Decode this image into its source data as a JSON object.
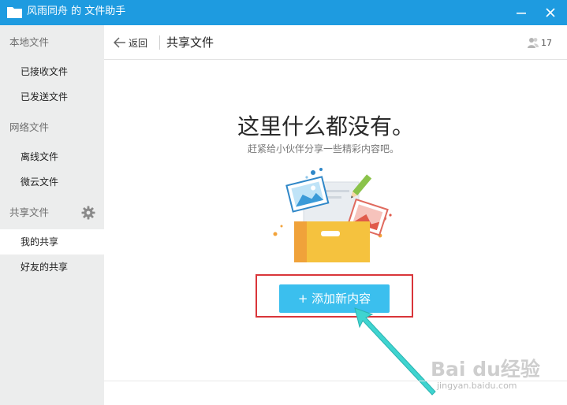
{
  "window": {
    "title": "风雨同舟 的 文件助手"
  },
  "sidebar": {
    "groups": [
      {
        "label": "本地文件",
        "items": [
          "已接收文件",
          "已发送文件"
        ]
      },
      {
        "label": "网络文件",
        "items": [
          "离线文件",
          "微云文件"
        ]
      },
      {
        "label": "共享文件",
        "items": [
          "我的共享",
          "好友的共享"
        ]
      }
    ],
    "active_item": "我的共享"
  },
  "header": {
    "back_label": "返回",
    "title": "共享文件",
    "member_count": "17"
  },
  "main": {
    "empty_title": "这里什么都没有。",
    "empty_subtitle": "赶紧给小伙伴分享一些精彩内容吧。",
    "add_button_label": "+ 添加新内容"
  },
  "watermark": {
    "logo": "Bai du经验",
    "url": "jingyan.baidu.com"
  },
  "colors": {
    "titlebar": "#1e9be0",
    "sidebar_bg": "#eceded",
    "add_button": "#3bbfee",
    "highlight_box": "#d9353a",
    "annotation_arrow": "#3fd4d0"
  }
}
